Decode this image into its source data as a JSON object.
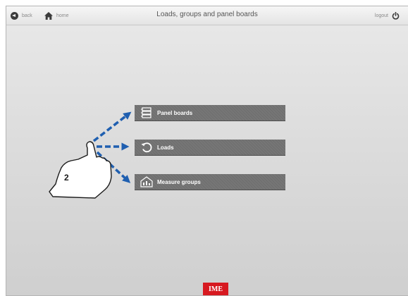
{
  "header": {
    "back_label": "back",
    "home_label": "home",
    "title": "Loads, groups and panel boards",
    "logout_label": "logout"
  },
  "menu": {
    "panel_boards": "Panel boards",
    "loads": "Loads",
    "measure_groups": "Measure groups"
  },
  "annotation": {
    "step": "2"
  },
  "footer": {
    "logo": "IME"
  },
  "colors": {
    "button_bg": "#707070",
    "arrow": "#1f5fb0",
    "logo_bg": "#d71920",
    "icon_dark": "#3c3c3c"
  },
  "icons": [
    "back-icon",
    "home-icon",
    "power-icon",
    "panel-boards-icon",
    "loads-icon",
    "measure-groups-icon",
    "pointing-hand-icon"
  ]
}
